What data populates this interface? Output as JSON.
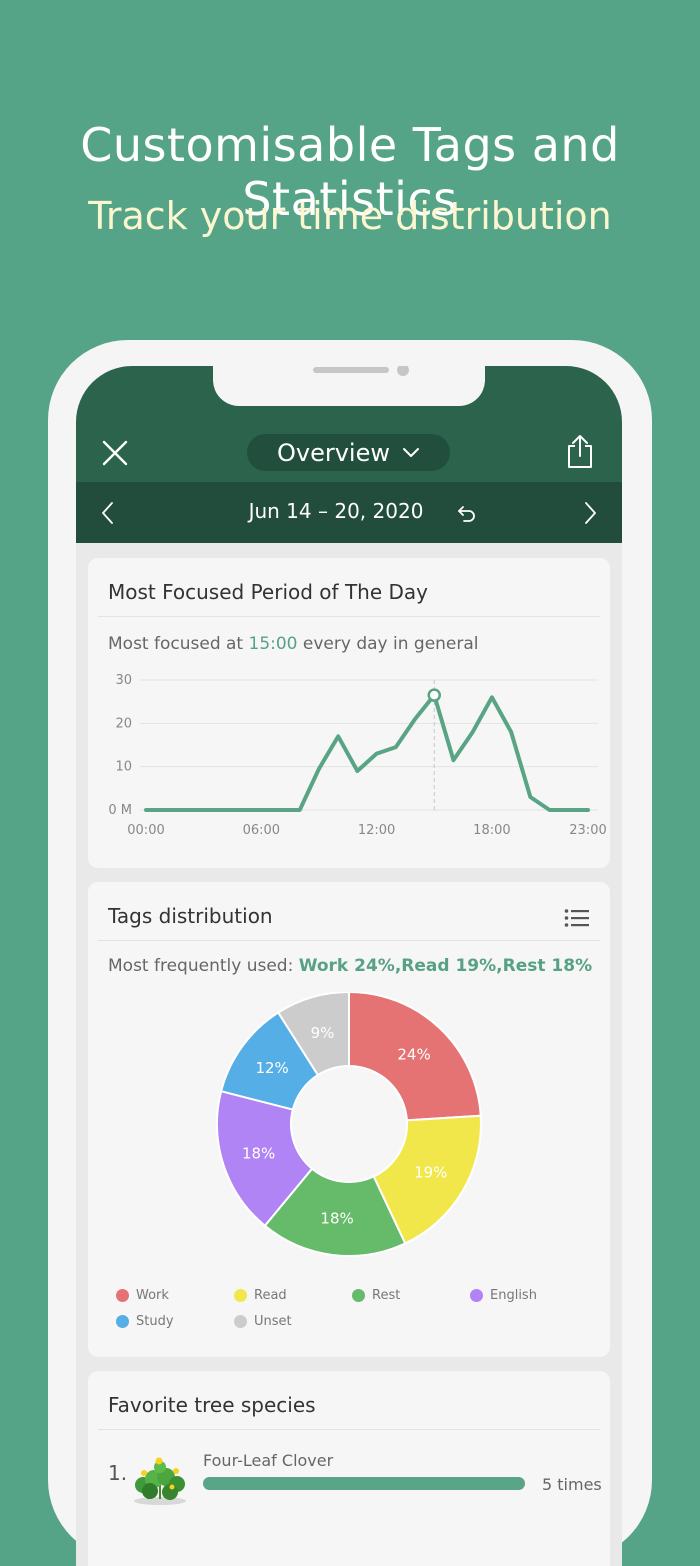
{
  "hero": {
    "title": "Customisable Tags and Statistics",
    "subtitle": "Track your time distribution"
  },
  "header": {
    "view_label": "Overview",
    "date_range": "Jun 14 – 20, 2020"
  },
  "focus_card": {
    "title": "Most Focused Period of The Day",
    "subtitle_prefix": "Most focused at ",
    "subtitle_time": "15:00",
    "subtitle_suffix": " every day in general"
  },
  "tags_card": {
    "title": "Tags distribution",
    "subtitle_prefix": "Most frequently used: ",
    "subtitle_highlight": "Work 24%,Read 19%,Rest 18%"
  },
  "trees_card": {
    "title": "Favorite tree species",
    "items": [
      {
        "rank": "1.",
        "name": "Four-Leaf Clover",
        "count": "5 times",
        "fraction": 1.0
      }
    ]
  },
  "colors": {
    "accent": "#57a184",
    "header": "#2b634c",
    "date_bar": "#224d3c",
    "background": "#55a487"
  },
  "chart_data": [
    {
      "type": "line",
      "title": "",
      "x": [
        "00:00",
        "01:00",
        "02:00",
        "03:00",
        "04:00",
        "05:00",
        "06:00",
        "07:00",
        "08:00",
        "09:00",
        "10:00",
        "11:00",
        "12:00",
        "13:00",
        "14:00",
        "15:00",
        "16:00",
        "17:00",
        "18:00",
        "19:00",
        "20:00",
        "21:00",
        "22:00",
        "23:00"
      ],
      "series": [
        {
          "values": [
            0,
            0,
            0,
            0,
            0,
            0,
            0,
            0,
            0,
            9.5,
            17,
            9,
            13,
            14.5,
            21,
            26.5,
            11.5,
            18,
            26,
            18,
            3,
            0,
            0,
            0
          ]
        }
      ],
      "x_tick_labels": [
        "00:00",
        "06:00",
        "12:00",
        "18:00",
        "23:00"
      ],
      "y_tick_labels": [
        "0 M",
        "10",
        "20",
        "30"
      ],
      "ylim": [
        0,
        30
      ],
      "highlight_x": "15:00",
      "grid": true,
      "color": "#5aa486"
    },
    {
      "type": "pie",
      "title": "",
      "donut": true,
      "slices": [
        {
          "label": "Work",
          "value": 24,
          "text": "24%",
          "color": "#e57373"
        },
        {
          "label": "Read",
          "value": 19,
          "text": "19%",
          "color": "#f2e74a"
        },
        {
          "label": "Rest",
          "value": 18,
          "text": "18%",
          "color": "#66bb6a"
        },
        {
          "label": "English",
          "value": 18,
          "text": "18%",
          "color": "#b084f5"
        },
        {
          "label": "Study",
          "value": 12,
          "text": "12%",
          "color": "#56aee6"
        },
        {
          "label": "Unset",
          "value": 9,
          "text": "9%",
          "color": "#cccccc"
        }
      ],
      "legend_position": "bottom"
    }
  ]
}
